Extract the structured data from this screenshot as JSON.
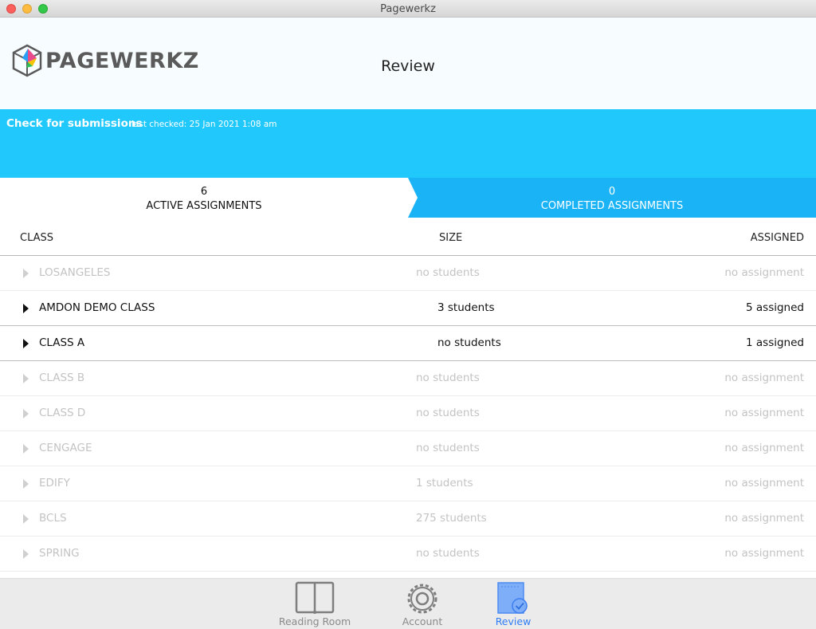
{
  "window": {
    "title": "Pagewerkz"
  },
  "header": {
    "logo_text": "PAGEWERKZ",
    "page_title": "Review"
  },
  "submissions": {
    "check_label": "Check for submissions",
    "last_checked": "last checked: 25 Jan 2021 1:08 am"
  },
  "tabs": {
    "active": {
      "count": "6",
      "label": "ACTIVE ASSIGNMENTS"
    },
    "completed": {
      "count": "0",
      "label": "COMPLETED ASSIGNMENTS"
    }
  },
  "columns": {
    "class": "CLASS",
    "size": "SIZE",
    "assigned": "ASSIGNED"
  },
  "rows": [
    {
      "class": "LOSANGELES",
      "size": "no students",
      "assigned": "no assignment",
      "enabled": false
    },
    {
      "class": "AMDON DEMO CLASS",
      "size": "3 students",
      "assigned": "5 assigned",
      "enabled": true
    },
    {
      "class": "CLASS A",
      "size": "no students",
      "assigned": "1 assigned",
      "enabled": true
    },
    {
      "class": "CLASS B",
      "size": "no students",
      "assigned": "no assignment",
      "enabled": false
    },
    {
      "class": "CLASS D",
      "size": "no students",
      "assigned": "no assignment",
      "enabled": false
    },
    {
      "class": "CENGAGE",
      "size": "no students",
      "assigned": "no assignment",
      "enabled": false
    },
    {
      "class": "EDIFY",
      "size": "1 students",
      "assigned": "no assignment",
      "enabled": false
    },
    {
      "class": "BCLS",
      "size": "275 students",
      "assigned": "no assignment",
      "enabled": false
    },
    {
      "class": "SPRING",
      "size": "no students",
      "assigned": "no assignment",
      "enabled": false
    }
  ],
  "tabbar": {
    "reading_room": {
      "label": "Reading Room",
      "icon": "book-icon"
    },
    "account": {
      "label": "Account",
      "icon": "gear-icon"
    },
    "review": {
      "label": "Review",
      "icon": "review-icon",
      "selected": true
    }
  },
  "colors": {
    "band": "#21c8fb",
    "completed_tab": "#1ab3f6",
    "tab_selected": "#2f7df6",
    "disabled_text": "#c3c3c3"
  }
}
